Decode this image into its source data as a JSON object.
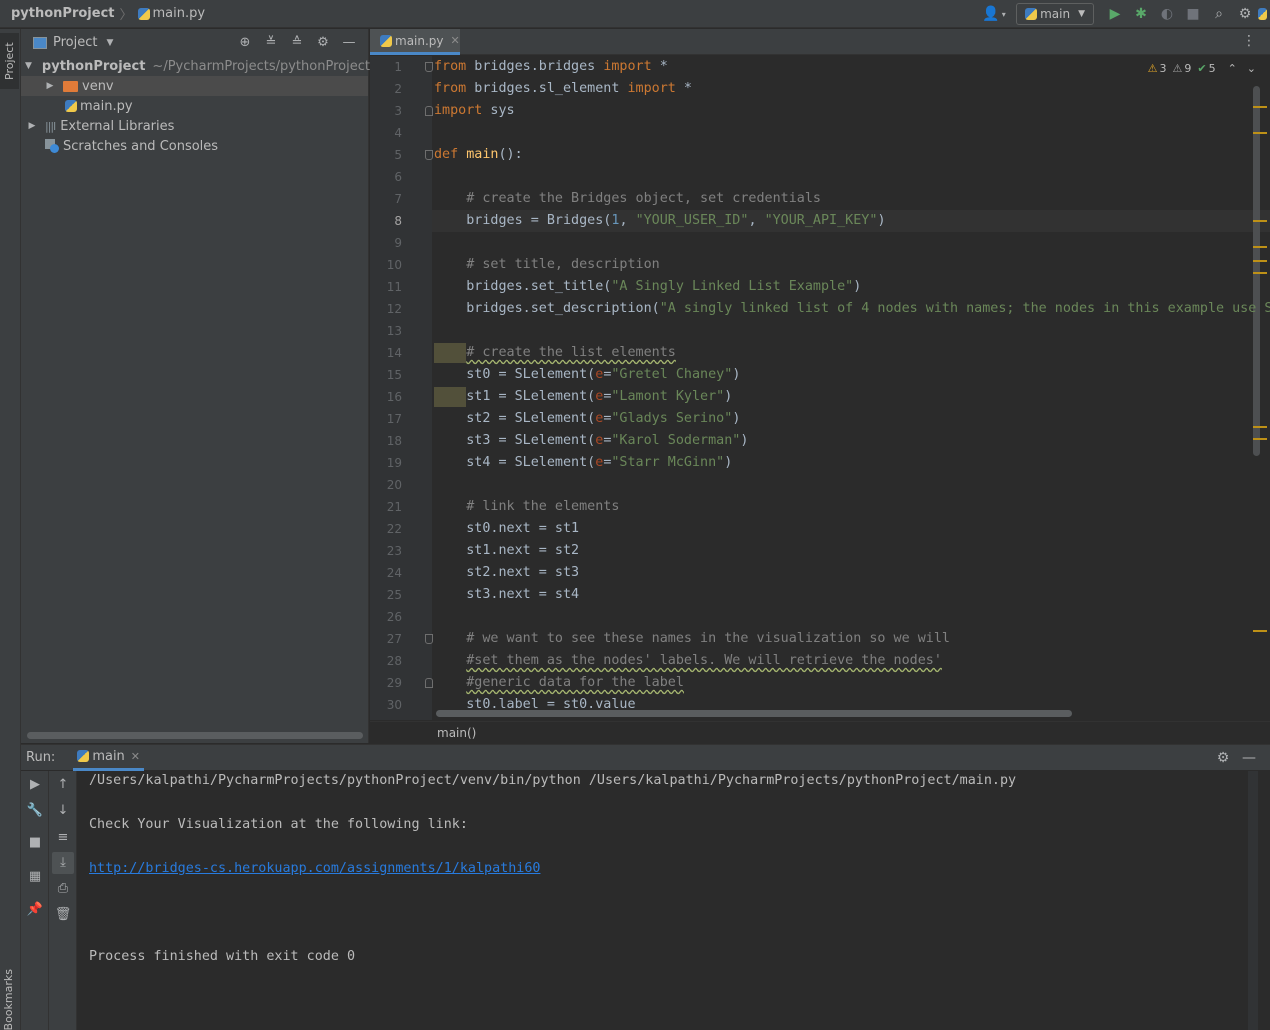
{
  "topbar": {
    "project_name": "pythonProject",
    "file_name": "main.py",
    "run_config": "main",
    "icons": [
      "user-icon",
      "run-icon",
      "debug-icon",
      "coverage-icon",
      "stop-icon",
      "search-icon",
      "settings-icon",
      "python-logo-icon"
    ]
  },
  "sidebar": {
    "project_tab": "Project",
    "bookmarks_tab": "Bookmarks"
  },
  "project_panel": {
    "title": "Project",
    "tree": [
      {
        "label": "pythonProject",
        "path": "~/PycharmProjects/pythonProject",
        "type": "root-folder",
        "expanded": true
      },
      {
        "label": "venv",
        "type": "folder",
        "expanded": false
      },
      {
        "label": "main.py",
        "type": "python-file"
      },
      {
        "label": "External Libraries",
        "type": "libraries",
        "expanded": false
      },
      {
        "label": "Scratches and Consoles",
        "type": "scratches"
      }
    ]
  },
  "editor": {
    "tab_label": "main.py",
    "inspections": {
      "warnings": "3",
      "weak_warnings": "9",
      "typos": "5"
    },
    "current_line": 8,
    "line_numbers": [
      "1",
      "2",
      "3",
      "4",
      "5",
      "6",
      "7",
      "8",
      "9",
      "10",
      "11",
      "12",
      "13",
      "14",
      "15",
      "16",
      "17",
      "18",
      "19",
      "20",
      "21",
      "22",
      "23",
      "24",
      "25",
      "26",
      "27",
      "28",
      "29",
      "30"
    ],
    "lines": [
      "from bridges.bridges import *",
      "from bridges.sl_element import *",
      "import sys",
      "",
      "def main():",
      "",
      "    # create the Bridges object, set credentials",
      "    bridges = Bridges(1, \"YOUR_USER_ID\", \"YOUR_API_KEY\")",
      "",
      "    # set title, description",
      "    bridges.set_title(\"A Singly Linked List Example\")",
      "    bridges.set_description(\"A singly linked list of 4 nodes with names; the nodes in this example use S",
      "",
      "    # create the list elements",
      "    st0 = SLelement(e=\"Gretel Chaney\")",
      "    st1 = SLelement(e=\"Lamont Kyler\")",
      "    st2 = SLelement(e=\"Gladys Serino\")",
      "    st3 = SLelement(e=\"Karol Soderman\")",
      "    st4 = SLelement(e=\"Starr McGinn\")",
      "",
      "    # link the elements",
      "    st0.next = st1",
      "    st1.next = st2",
      "    st2.next = st3",
      "    st3.next = st4",
      "",
      "    # we want to see these names in the visualization so we will",
      "    #set them as the nodes' labels. We will retrieve the nodes'",
      "    #generic data for the label",
      "    st0.label = st0.value"
    ],
    "breadcrumb": "main()"
  },
  "run_panel": {
    "label": "Run:",
    "tab_label": "main",
    "output": [
      "/Users/kalpathi/PycharmProjects/pythonProject/venv/bin/python /Users/kalpathi/PycharmProjects/pythonProject/main.py",
      "",
      "Check Your Visualization at the following link:",
      "",
      "http://bridges-cs.herokuapp.com/assignments/1/kalpathi60",
      "",
      "",
      "",
      "Process finished with exit code 0"
    ]
  },
  "colors": {
    "keyword": "#cc7832",
    "string": "#6a8759",
    "comment": "#808080",
    "number": "#6897bb",
    "function": "#ffc66d",
    "link": "#287bde",
    "accent": "#4a88c7"
  }
}
